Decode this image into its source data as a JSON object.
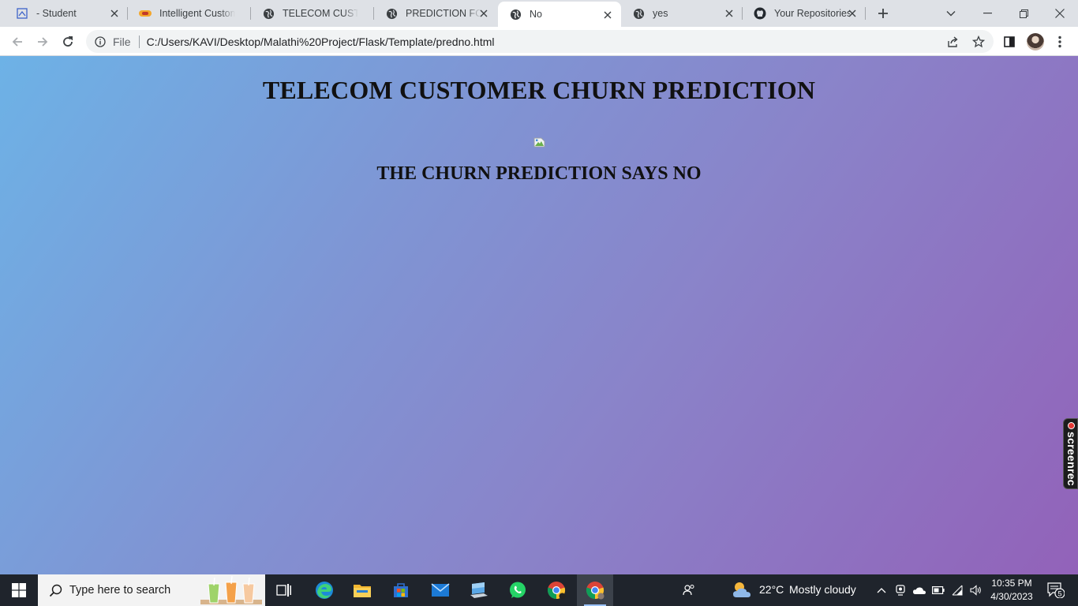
{
  "browser": {
    "tabs": [
      {
        "title": "- Student",
        "icon": "student-icon"
      },
      {
        "title": "Intelligent Customer",
        "icon": "app-icon"
      },
      {
        "title": "TELECOM CUSTOMER",
        "icon": "globe-icon"
      },
      {
        "title": "PREDICTION FOR",
        "icon": "globe-icon"
      },
      {
        "title": "No",
        "icon": "globe-icon",
        "active": true
      },
      {
        "title": "yes",
        "icon": "globe-icon"
      },
      {
        "title": "Your Repositories",
        "icon": "github-icon"
      }
    ],
    "address": {
      "scheme_label": "File",
      "url": "C:/Users/KAVI/Desktop/Malathi%20Project/Flask/Template/predno.html"
    }
  },
  "page": {
    "heading": "TELECOM CUSTOMER CHURN PREDICTION",
    "result": "THE CHURN PREDICTION SAYS NO"
  },
  "overlay": {
    "screenrec_label": "screenrec"
  },
  "taskbar": {
    "search_placeholder": "Type here to search",
    "weather_temp": "22°C",
    "weather_condition": "Mostly cloudy",
    "time": "10:35 PM",
    "date": "4/30/2023",
    "notification_count": "5"
  },
  "colors": {
    "gradient_start": "#6db2e6",
    "gradient_end": "#9262b9",
    "accent_blue": "#1a73e8"
  }
}
